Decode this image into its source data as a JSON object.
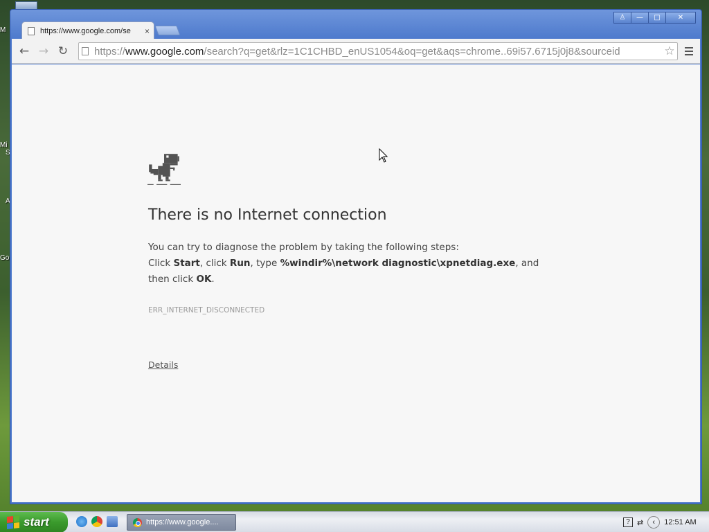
{
  "desktop": {
    "labels": [
      "M",
      "Mi",
      "S",
      "A",
      "Go"
    ]
  },
  "window": {
    "controls": {
      "profile": "♙",
      "minimize": "—",
      "maximize": "□",
      "close": "✕"
    }
  },
  "tab": {
    "title": "https://www.google.com/se",
    "close": "×"
  },
  "toolbar": {
    "back": "←",
    "forward": "→",
    "reload": "↻",
    "url_scheme": "https://",
    "url_host": "www.google.com",
    "url_path": "/search?q=get&rlz=1C1CHBD_enUS1054&oq=get&aqs=chrome..69i57.6715j0j8&sourceid",
    "star": "☆"
  },
  "page": {
    "title": "There is no Internet connection",
    "line1": "You can try to diagnose the problem by taking the following steps:",
    "line2_click": "Click ",
    "line2_start": "Start",
    "line2_click2": ", click ",
    "line2_run": "Run",
    "line2_type": ", type ",
    "line2_cmd": "%windir%\\network diagnostic\\xpnetdiag.exe",
    "line2_and": ", and",
    "line3_then": "then click ",
    "line3_ok": "OK",
    "line3_end": ".",
    "error_code": "ERR_INTERNET_DISCONNECTED",
    "details_link": "Details"
  },
  "taskbar": {
    "start_label": "start",
    "task_item": "https://www.google....",
    "clock": "12:51 AM",
    "help_icon": "?",
    "back_icon": "‹"
  },
  "colors": {
    "window_frame": "#4f7bcd",
    "content_bg": "#f7f7f7",
    "start_button": "#3a9a2c"
  }
}
